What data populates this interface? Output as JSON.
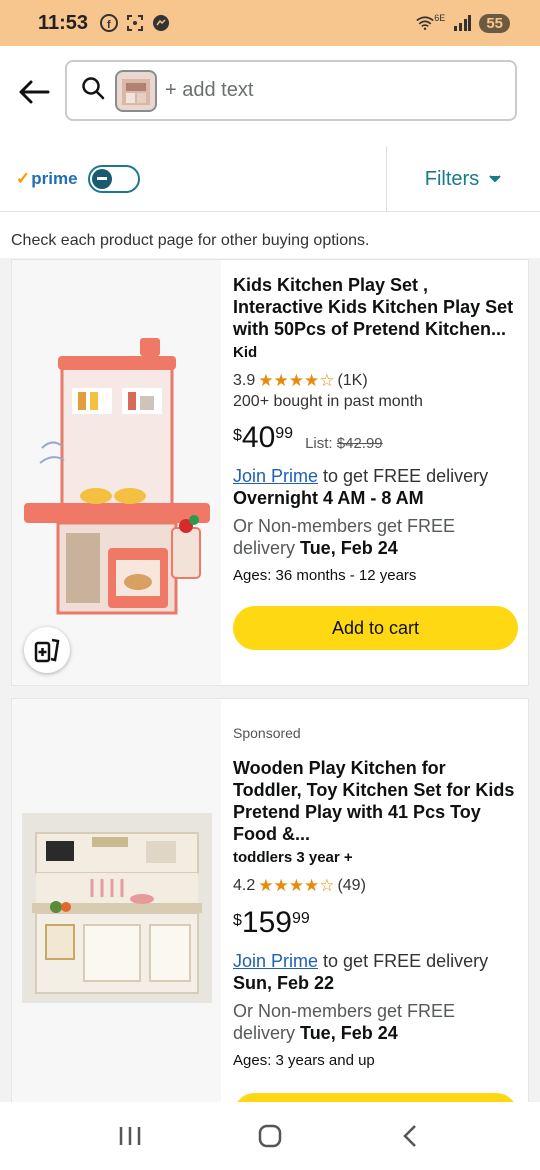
{
  "status_bar": {
    "time": "11:53",
    "network": "6E",
    "battery": "55"
  },
  "search": {
    "placeholder": "+ add text"
  },
  "filter_bar": {
    "prime_label": "prime",
    "filters_label": "Filters"
  },
  "results_note": "Check each product page for other buying options.",
  "products": [
    {
      "title": "Kids Kitchen Play Set , Interactive Kids Kitchen Play Set with 50Pcs of Pretend Kitchen...",
      "brand": "Kid",
      "rating": "3.9",
      "stars": "★★★★☆",
      "reviews": "(1K)",
      "bought": "200+ bought in past month",
      "price_symbol": "$",
      "price_whole": "40",
      "price_fraction": "99",
      "list_label": "List:",
      "list_price": "$42.99",
      "join_prime": "Join Prime",
      "delivery_text": " to get FREE delivery",
      "delivery_date": "Overnight 4 AM - 8 AM",
      "nonmember_text": "Or Non-members get FREE delivery ",
      "nonmember_date": "Tue, Feb 24",
      "ages": "Ages: 36 months - 12 years",
      "cart_label": "Add to cart"
    },
    {
      "sponsored": "Sponsored",
      "title": "Wooden Play Kitchen for Toddler, Toy Kitchen Set for Kids Pretend Play with 41 Pcs Toy Food &...",
      "brand": "toddlers 3 year +",
      "rating": "4.2",
      "stars": "★★★★☆",
      "reviews": "(49)",
      "price_symbol": "$",
      "price_whole": "159",
      "price_fraction": "99",
      "join_prime": "Join Prime",
      "delivery_text": " to get FREE delivery",
      "delivery_date": "Sun, Feb 22",
      "nonmember_text": "Or Non-members get FREE delivery ",
      "nonmember_date": "Tue, Feb 24",
      "ages": "Ages: 3 years and up"
    }
  ],
  "colors": {
    "status_bar": "#f7c58e",
    "cart_button": "#ffd814",
    "link": "#1f5fb5",
    "teal": "#1a7a8c",
    "star": "#e88a0a"
  }
}
